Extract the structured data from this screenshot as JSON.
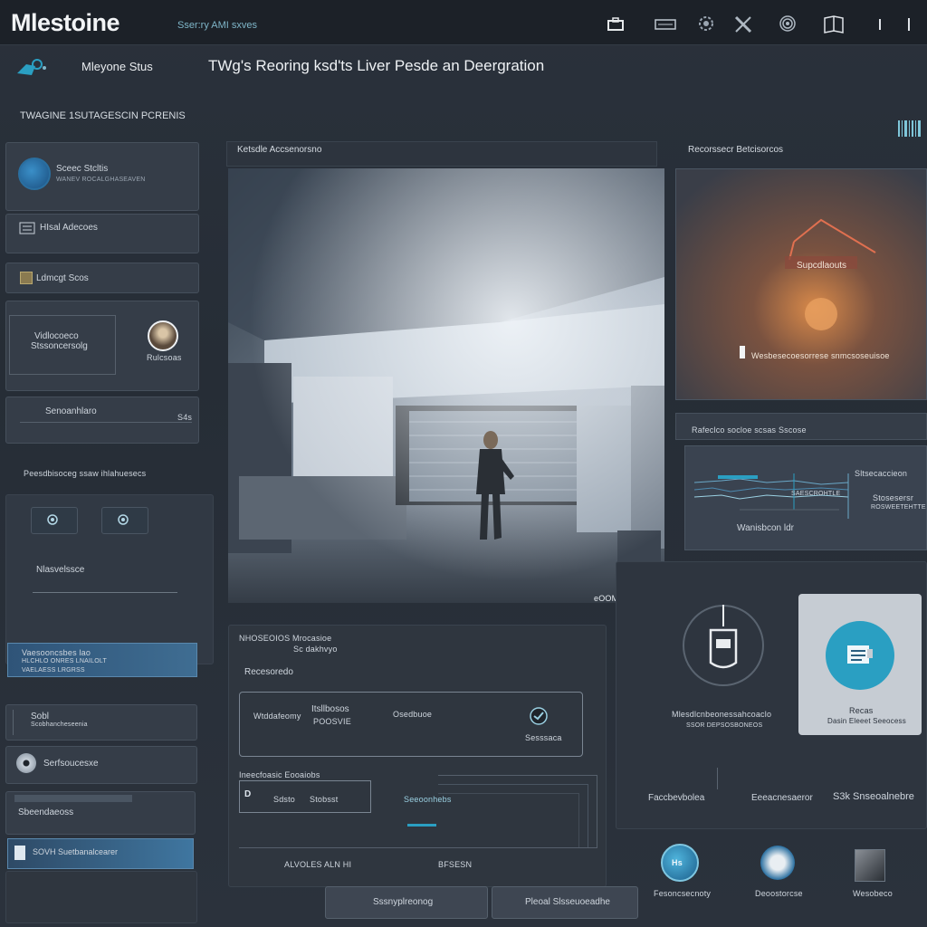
{
  "app": {
    "logo": "Mlestoine",
    "subtitle": "Sser:ry AMI sxves"
  },
  "header": {
    "label": "Mleyone Stus",
    "title": "TWg's Reoring ksd'ts Liver Pesde an Deergration"
  },
  "left": {
    "section_title": "TWAGINE 1SUTAGESCIN PCRENIS",
    "profile": {
      "name": "Sceec Stcltis",
      "sub": "WANEV ROCALGHASEAVEN"
    },
    "item1": "HIsal Adecoes",
    "item2": "Ldmcgt Scos",
    "card": {
      "text1": "Vidlocoeco",
      "text2": "Stssoncersolg",
      "caption": "Rulcsoas"
    },
    "item3": {
      "label": "Senoanhlaro",
      "tag": "S4s"
    },
    "section2_title": "Peesdbisoceg ssaw ihlahuesecs",
    "widget_label": "Nlasvelssce",
    "highlight": {
      "line1": "Vaesooncsbes lao",
      "line2": "HLCHLO ONRES LNAILOLT",
      "line3": "VAELAESS LRGRSS"
    },
    "item4": {
      "label": "Sobl",
      "sub": "Scobhancheseenia"
    },
    "item5": "Serfsoucesxe",
    "item6": "Sbeendaeoss",
    "item7": "SOVH Suetbanalcearer"
  },
  "center": {
    "title": "Ketsdle Accsenorsno",
    "timestamp": "eOOMOLSEIJD",
    "subpanel": {
      "header1": "NHOSEOIOS Mrocasioe",
      "header2": "Sc dakhvyo",
      "label": "Recesoredo",
      "card_label": "Wtddafeomy",
      "card_title": "Itsllbosos",
      "card_title2": "POOSVIE",
      "card_right": "Osedbuoe",
      "card_badge": "Sesssaca",
      "section_label": "Ineecfoasic Eooaiobs",
      "field_a": "Sdsto",
      "field_b": "Stobsst",
      "field_c": "Seeoonhebs",
      "footer_a": "ALVOLES ALN HI",
      "footer_b": "BFSESN"
    }
  },
  "right": {
    "title1": "Recorssecr Betcisorcos",
    "video_label": "Supcdlaouts",
    "video_caption": "Wesbesecoesorrese snmcsoseuisoe",
    "title2": "Rafeclco socloe scsas Sscose",
    "chart_right1": "Sltsecaccieon",
    "chart_right2": "Stosesersr",
    "chart_right3": "ROSWEETEHTTE",
    "chart_foot1": "SAESCROHTLE",
    "chart_foot2": "Wanisbcon ldr",
    "device_caption1": "Mlesdlcnbeonessahcoaclo",
    "device_caption2": "SSOR DEPSOSBONEOS",
    "card_label": "Recas",
    "card_sub": "Dasin Eleeet Seeocess",
    "row_a": "Faccbevbolea",
    "row_b": "Eeeacnesaeror",
    "row_c": "S3k Snseoalnebre",
    "icon_a": "Fesoncsecnoty",
    "icon_b": "Deoostorcse",
    "icon_c": "Wesobeco"
  },
  "bottom": {
    "btn1": "Sssnyplreonog",
    "btn2": "Pleoal Slsseuoeadhe"
  },
  "colors": {
    "accent": "#2a9fc2",
    "highlight_bar": "#3f6d92",
    "background": "#272e37"
  },
  "icons": [
    "tool-icon-1",
    "tool-icon-2",
    "tool-icon-3",
    "tool-icon-4",
    "tool-icon-5",
    "tool-icon-6",
    "tool-icon-7"
  ]
}
